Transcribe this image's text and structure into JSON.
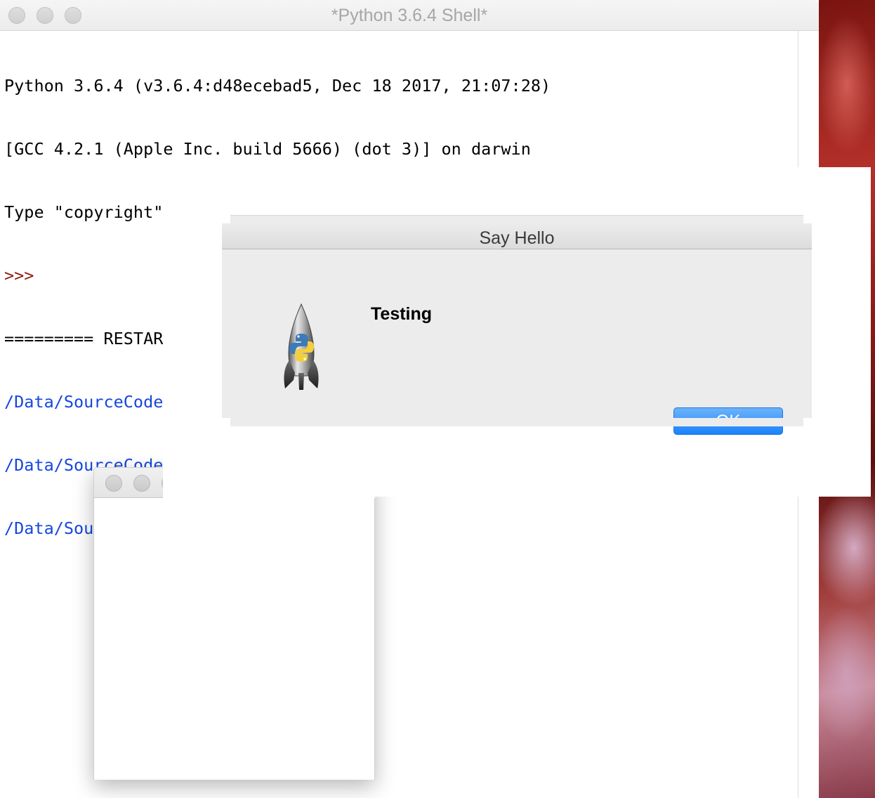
{
  "shell": {
    "title": "*Python 3.6.4 Shell*",
    "lines": [
      "Python 3.6.4 (v3.6.4:d48ecebad5, Dec 18 2017, 21:07:28)",
      "[GCC 4.2.1 (Apple Inc. build 5666) (dot 3)] on darwin",
      "Type \"copyright\", \"credits\" or \"license()\" for more information.",
      ">>>",
      "========= RESTART: /Data/SourceCode/beingFunWithPython/renameFile.py =========",
      "/Data/SourceCode/beingFunWithPython",
      "/Data/SourceCode/beingFunWithPython/renameFile.py",
      "/Data/SourceCode/"
    ]
  },
  "dialog": {
    "title": "Say Hello",
    "message": "Testing",
    "ok_label": "OK",
    "icon": "python-launcher-rocket-icon"
  },
  "colors": {
    "prompt": "#8b1a0c",
    "stdout_path": "#1646e0",
    "ok_button": "#1a82fb"
  }
}
